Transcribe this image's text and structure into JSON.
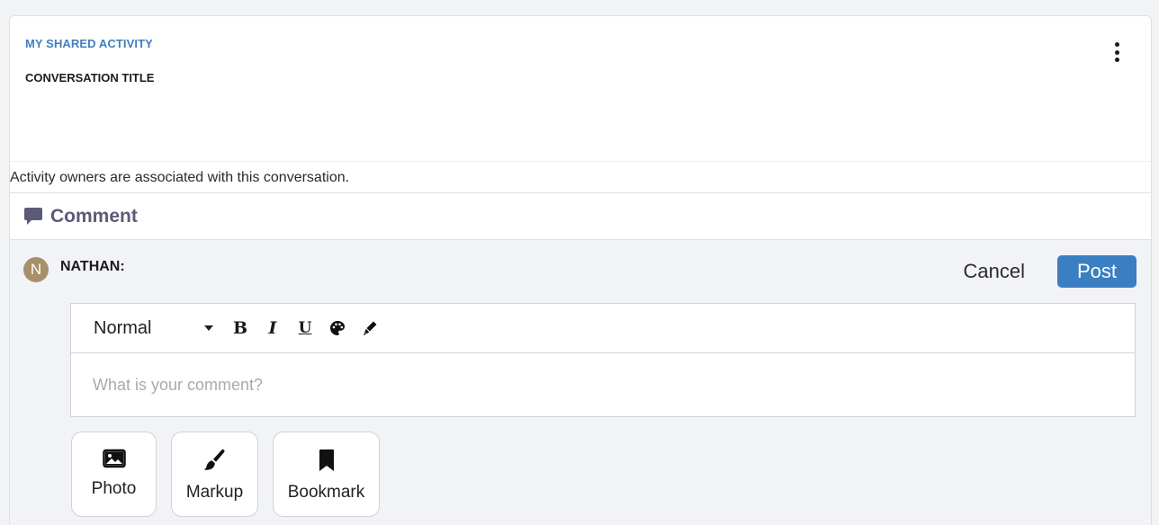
{
  "card": {
    "activity_label": "MY SHARED ACTIVITY",
    "conversation_title": "CONVERSATION TITLE",
    "owners_note": "Activity owners are associated with this conversation."
  },
  "comment_section": {
    "heading": "Comment",
    "icon": "comment-icon"
  },
  "composer": {
    "user_initial": "N",
    "user_name": "NATHAN:",
    "cancel_label": "Cancel",
    "post_label": "Post",
    "accent_color": "#3a7fc1",
    "toolbar": {
      "format_value": "Normal",
      "bold": "B",
      "italic": "I",
      "underline": "U",
      "color_icon": "palette-icon",
      "highlight_icon": "marker-icon"
    },
    "placeholder": "What is your comment?"
  },
  "attachments": [
    {
      "label": "Photo",
      "icon": "photo-icon"
    },
    {
      "label": "Markup",
      "icon": "paintbrush-icon"
    },
    {
      "label": "Bookmark",
      "icon": "bookmark-icon"
    }
  ]
}
